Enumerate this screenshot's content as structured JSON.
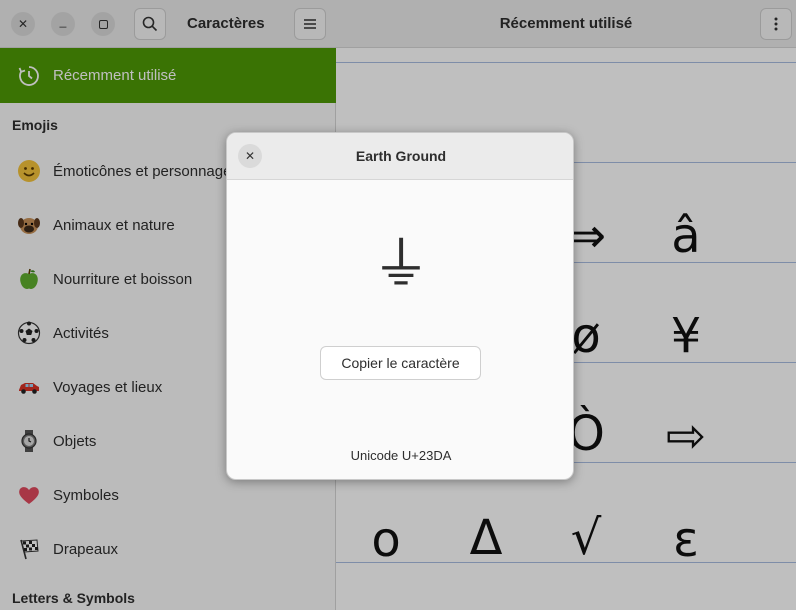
{
  "sidebar": {
    "title": "Caractères",
    "recent_label": "Récemment utilisé",
    "emojis_section": "Emojis",
    "categories": [
      {
        "label": "Émoticônes et personnages",
        "icon": "smiley-icon"
      },
      {
        "label": "Animaux et nature",
        "icon": "dog-icon"
      },
      {
        "label": "Nourriture et boisson",
        "icon": "apple-icon"
      },
      {
        "label": "Activités",
        "icon": "soccer-ball-icon"
      },
      {
        "label": "Voyages et lieux",
        "icon": "car-icon"
      },
      {
        "label": "Objets",
        "icon": "watch-icon"
      },
      {
        "label": "Symboles",
        "icon": "heart-icon"
      },
      {
        "label": "Drapeaux",
        "icon": "checkered-flag-icon"
      }
    ],
    "letters_section": "Letters & Symbols"
  },
  "main": {
    "title": "Récemment utilisé",
    "glyphs": [
      {
        "char": "⇒"
      },
      {
        "char": "â"
      },
      {
        "char": "ø"
      },
      {
        "char": "¥"
      },
      {
        "char": "Ò"
      },
      {
        "char": "⇨"
      },
      {
        "char": "o"
      },
      {
        "char": "Δ"
      },
      {
        "char": "√"
      },
      {
        "char": "ε"
      }
    ]
  },
  "dialog": {
    "title": "Earth Ground",
    "glyph": "⏚",
    "copy_label": "Copier le caractère",
    "codepoint": "Unicode U+23DA"
  },
  "colors": {
    "accent": "#4e9a06",
    "headerbar": "#ebebeb",
    "grid_line": "#a9bde0"
  }
}
